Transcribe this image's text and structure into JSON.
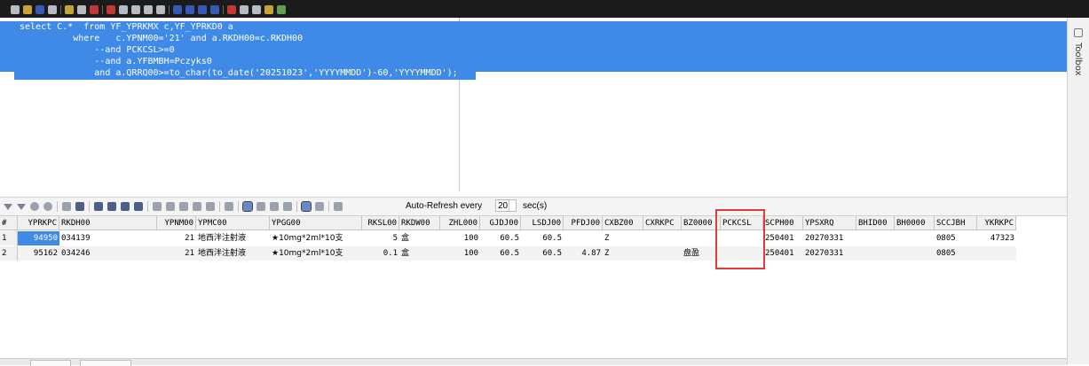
{
  "editor": {
    "sql_lines": [
      "select C.*  from YF_YPRKMX c,YF_YPRKD0 a",
      "          where   c.YPNM00='21' and a.RKDH00=c.RKDH00",
      "              --and PCKCSL>=0",
      "              --and a.YFBMBH=Pczyks0",
      "              and a.QRRQ00>=to_char(to_date('20251023','YYYYMMDD')-60,'YYYYMMDD');"
    ]
  },
  "toolbox": {
    "label": "Toolbox"
  },
  "grid_toolbar": {
    "auto_refresh_label": "Auto-Refresh every",
    "interval_value": "20",
    "unit_label": "sec(s)"
  },
  "results": {
    "row_number_header": "#",
    "columns": [
      "YPRKPC",
      "RKDH00",
      "YPNM00",
      "YPMC00",
      "YPGG00",
      "RKSL00",
      "RKDW00",
      "ZHL000",
      "GJDJ00",
      "LSDJ00",
      "PFDJ00",
      "CXBZ00",
      "CXRKPC",
      "BZ0000",
      "PCKCSL",
      "SCPH00",
      "YPSXRQ",
      "BHID00",
      "BH0000",
      "SCCJBH",
      "YKRKPC"
    ],
    "rows": [
      {
        "rn": "1",
        "YPRKPC": "94950",
        "RKDH00": "034139",
        "YPNM00": "21",
        "YPMC00": "地西泮注射液",
        "YPGG00": "★10mg*2ml*10支",
        "RKSL00": "5",
        "RKDW00": "盒",
        "ZHL000": "100",
        "GJDJ00": "60.5",
        "LSDJ00": "60.5",
        "PFDJ00": "",
        "CXBZ00": "Z",
        "CXRKPC": "",
        "BZ0000": "",
        "PCKCSL": "",
        "SCPH00": "250401",
        "YPSXRQ": "20270331",
        "BHID00": "",
        "BH0000": "",
        "SCCJBH": "0805",
        "YKRKPC": "47323"
      },
      {
        "rn": "2",
        "YPRKPC": "95162",
        "RKDH00": "034246",
        "YPNM00": "21",
        "YPMC00": "地西泮注射液",
        "YPGG00": "★10mg*2ml*10支",
        "RKSL00": "0.1",
        "RKDW00": "盒",
        "ZHL000": "100",
        "GJDJ00": "60.5",
        "LSDJ00": "60.5",
        "PFDJ00": "4.87",
        "CXBZ00": "Z",
        "CXRKPC": "",
        "BZ0000": "盘盈",
        "PCKCSL": "",
        "SCPH00": "250401",
        "YPSXRQ": "20270331",
        "BHID00": "",
        "BH0000": "",
        "SCCJBH": "0805",
        "YKRKPC": ""
      }
    ]
  },
  "colors": {
    "selection": "#3f8ae6",
    "highlight_box": "#e03a3a",
    "title_bar": "#1b1b1b"
  }
}
